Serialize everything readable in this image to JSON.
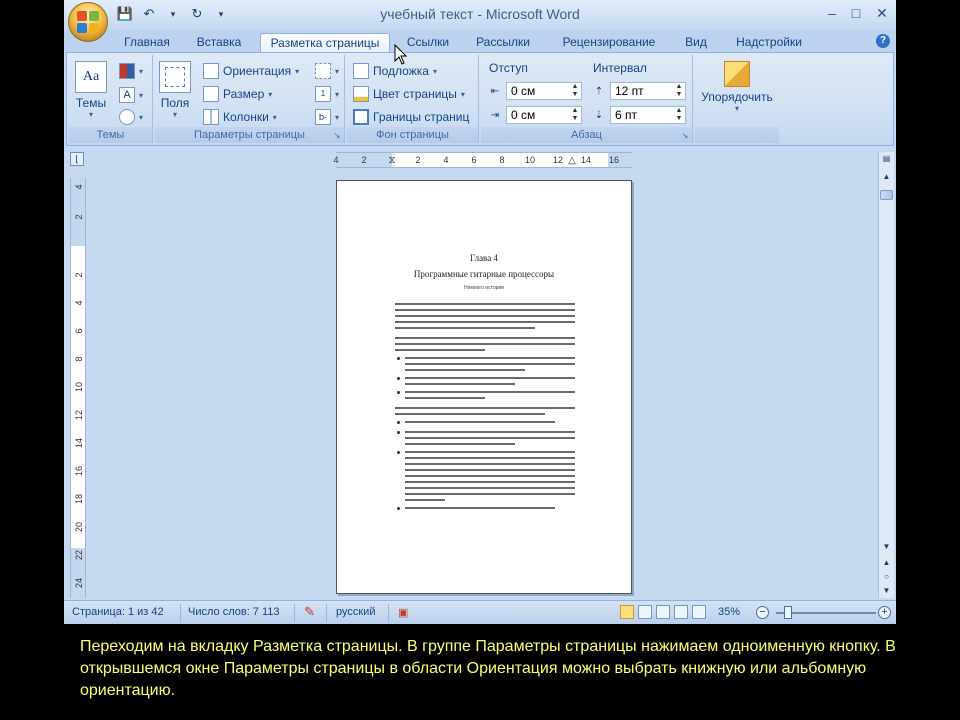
{
  "window": {
    "title": "учебный текст - Microsoft Word",
    "controls": {
      "minimize": "–",
      "maximize": "□",
      "close": "✕"
    }
  },
  "quick_access": {
    "save_icon": "save-icon",
    "undo_icon": "undo-icon",
    "redo_icon": "redo-icon",
    "customize": "▾"
  },
  "tabs": [
    {
      "label": "Главная"
    },
    {
      "label": "Вставка"
    },
    {
      "label": "Разметка страницы",
      "active": true
    },
    {
      "label": "Ссылки"
    },
    {
      "label": "Рассылки"
    },
    {
      "label": "Рецензирование"
    },
    {
      "label": "Вид"
    },
    {
      "label": "Надстройки"
    }
  ],
  "ribbon": {
    "themes": {
      "group": "Темы",
      "button": "Темы"
    },
    "page_setup": {
      "group": "Параметры страницы",
      "margins": "Поля",
      "orientation": "Ориентация",
      "size": "Размер",
      "columns": "Колонки"
    },
    "page_background": {
      "group": "Фон страницы",
      "watermark": "Подложка",
      "page_color": "Цвет страницы",
      "page_borders": "Границы страниц"
    },
    "paragraph": {
      "group": "Абзац",
      "indent_label": "Отступ",
      "indent_left": "0 см",
      "indent_right": "0 см",
      "spacing_label": "Интервал",
      "spacing_before": "12 пт",
      "spacing_after": "6 пт"
    },
    "arrange": {
      "button": "Упорядочить"
    }
  },
  "ruler": {
    "horizontal_ticks": [
      "4",
      "2",
      "2",
      "4",
      "6",
      "8",
      "10",
      "12",
      "14",
      "16"
    ],
    "vertical_ticks": [
      "4",
      "2",
      "2",
      "4",
      "6",
      "8",
      "10",
      "12",
      "14",
      "16",
      "18",
      "20",
      "22",
      "24"
    ]
  },
  "document": {
    "chapter": "Глава 4",
    "heading": "Программные гитарные процессоры",
    "subheading": "Немного истории"
  },
  "status": {
    "page": "Страница: 1 из 42",
    "words": "Число слов: 7 113",
    "language": "русский",
    "zoom": "35%",
    "zoom_minus": "−",
    "zoom_plus": "+"
  },
  "caption": "Переходим на вкладку Разметка страницы. В группе Параметры страницы нажимаем одноименную кнопку. В открывшемся окне Параметры страницы в области Ориентация можно выбрать книжную или альбомную ориентацию."
}
